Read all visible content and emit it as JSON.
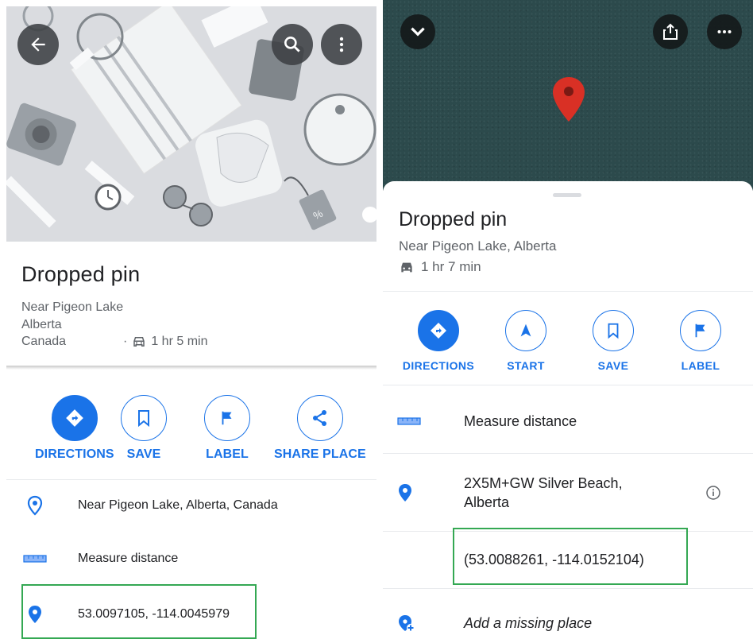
{
  "left": {
    "title": "Dropped pin",
    "address_lines": [
      "Near Pigeon Lake",
      "Alberta",
      "Canada"
    ],
    "drive_separator": "·",
    "drive_time": "1 hr 5 min",
    "actions": [
      {
        "label": "DIRECTIONS",
        "icon": "directions-icon"
      },
      {
        "label": "SAVE",
        "icon": "bookmark-icon"
      },
      {
        "label": "LABEL",
        "icon": "flag-icon"
      },
      {
        "label": "SHARE PLACE",
        "icon": "share-icon"
      }
    ],
    "rows": [
      {
        "icon": "location-outline-icon",
        "text": "Near Pigeon Lake, Alberta, Canada"
      },
      {
        "icon": "ruler-icon",
        "text": "Measure distance"
      },
      {
        "icon": "location-pin-icon",
        "text": "53.0097105, -114.0045979"
      }
    ]
  },
  "right": {
    "title": "Dropped pin",
    "subtitle": "Near Pigeon Lake, Alberta",
    "drive_time": "1 hr 7 min",
    "actions": [
      {
        "label": "DIRECTIONS",
        "icon": "directions-icon"
      },
      {
        "label": "START",
        "icon": "navigation-arrow-icon"
      },
      {
        "label": "SAVE",
        "icon": "bookmark-icon"
      },
      {
        "label": "LABEL",
        "icon": "flag-icon"
      }
    ],
    "rows": [
      {
        "icon": "ruler-icon",
        "text": "Measure distance"
      },
      {
        "icon": "location-pin-icon",
        "text": "2X5M+GW Silver Beach, Alberta"
      },
      {
        "icon": "",
        "text": "(53.0088261, -114.0152104)"
      },
      {
        "icon": "add-place-icon",
        "text": "Add a missing place"
      }
    ]
  },
  "colors": {
    "accent": "#1a73e8",
    "highlight": "#34a853",
    "map_marker": "#d93025",
    "text_primary": "#202124",
    "text_secondary": "#5f6368"
  }
}
